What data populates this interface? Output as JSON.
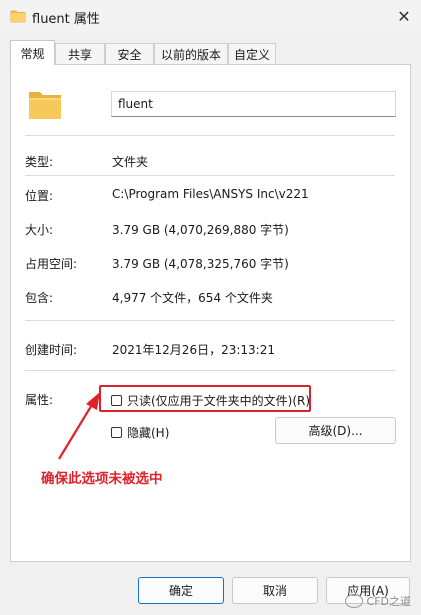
{
  "window": {
    "title": "fluent 属性"
  },
  "tabs": [
    {
      "label": "常规",
      "active": true
    },
    {
      "label": "共享"
    },
    {
      "label": "安全"
    },
    {
      "label": "以前的版本"
    },
    {
      "label": "自定义"
    }
  ],
  "general": {
    "name_value": "fluent",
    "type_label": "类型:",
    "type_value": "文件夹",
    "location_label": "位置:",
    "location_value": "C:\\Program Files\\ANSYS Inc\\v221",
    "size_label": "大小:",
    "size_value": "3.79 GB (4,070,269,880 字节)",
    "disk_label": "占用空间:",
    "disk_value": "3.79 GB (4,078,325,760 字节)",
    "contains_label": "包含:",
    "contains_value": "4,977 个文件，654 个文件夹",
    "created_label": "创建时间:",
    "created_value": "2021年12月26日，23:13:21",
    "attributes_label": "属性:",
    "readonly_label": "只读(仅应用于文件夹中的文件)(R)",
    "readonly_checked": false,
    "hidden_label": "隐藏(H)",
    "hidden_checked": false,
    "advanced_label": "高级(D)..."
  },
  "annotation": {
    "text": "确保此选项未被选中",
    "color": "#e0222a"
  },
  "footer": {
    "ok_label": "确定",
    "cancel_label": "取消",
    "apply_label": "应用(A)"
  },
  "watermark": {
    "text": "CFD之道"
  },
  "colors": {
    "highlight": "#d9232a",
    "accent": "#1a6fc9",
    "folder": "#f5c04a"
  },
  "icons": {
    "title": "folder-icon",
    "close": "close-icon",
    "main": "folder-icon",
    "annotation": "arrow-icon"
  }
}
